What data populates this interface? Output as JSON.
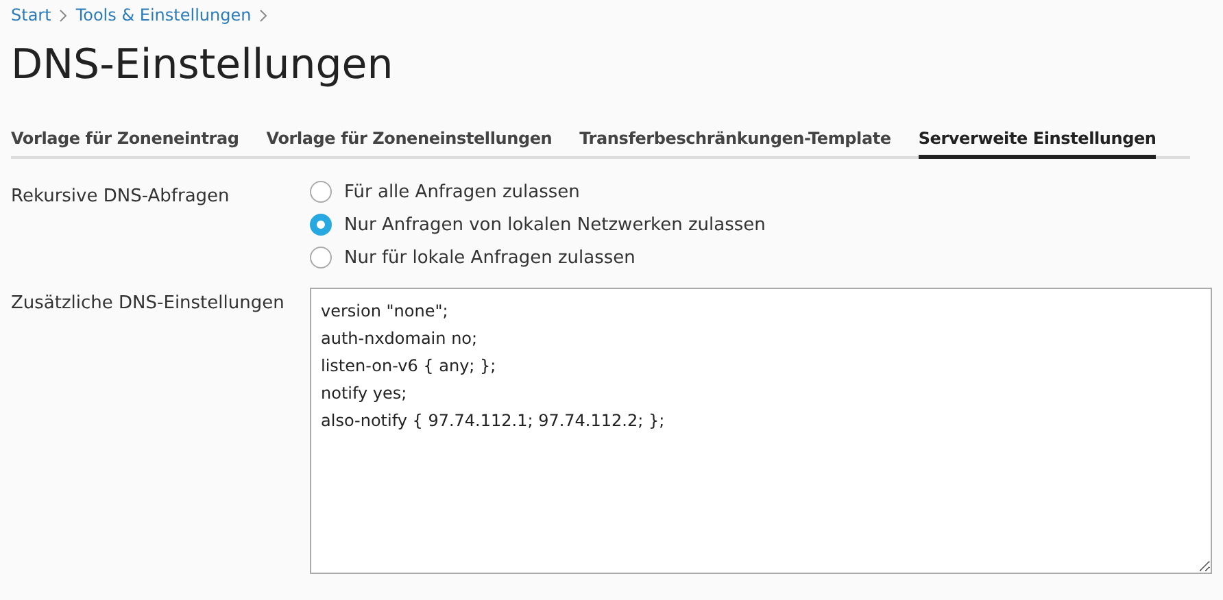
{
  "breadcrumbs": [
    "Start",
    "Tools & Einstellungen"
  ],
  "title": "DNS-Einstellungen",
  "tabs": [
    {
      "label": "Vorlage für Zoneneintrag",
      "selected": false
    },
    {
      "label": "Vorlage für Zoneneinstellungen",
      "selected": false
    },
    {
      "label": "Transferbeschränkungen-Template",
      "selected": false
    },
    {
      "label": "Serverweite Einstellungen",
      "selected": true
    }
  ],
  "recursion": {
    "label": "Rekursive DNS-Abfragen",
    "options": [
      {
        "label": "Für alle Anfragen zulassen",
        "selected": false
      },
      {
        "label": "Nur Anfragen von lokalen Netzwerken zulassen",
        "selected": true
      },
      {
        "label": "Nur für lokale Anfragen zulassen",
        "selected": false
      }
    ]
  },
  "extra": {
    "label": "Zusätzliche DNS-Einstellungen",
    "value": "version \"none\";\nauth-nxdomain no;\nlisten-on-v6 { any; };\nnotify yes;\nalso-notify { 97.74.112.1; 97.74.112.2; };"
  }
}
